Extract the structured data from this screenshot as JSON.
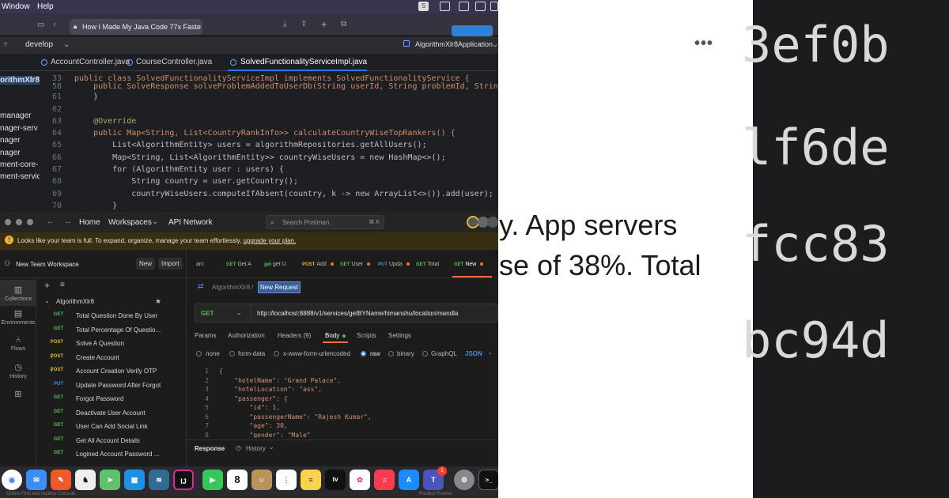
{
  "menubar": {
    "items": [
      "Window",
      "Help"
    ],
    "icons": [
      "s-icon",
      "sidebar-icon",
      "screen-icon",
      "cast-icon",
      "notch-icon"
    ]
  },
  "safari": {
    "url": "How I Made My Java Code 77x Faste"
  },
  "ide": {
    "branch": "develop",
    "run_config": "AlgorithmXlr8Application",
    "tabs": [
      "AccountController.java",
      "CourseController.java",
      "SolvedFunctionalityServiceImpl.java"
    ],
    "project_items": [
      "orithmXlr8",
      "manager",
      "nager-serv",
      "nager",
      "nager",
      "ment-core-",
      "ment-servic"
    ],
    "code": [
      {
        "n": "33",
        "t": "public class SolvedFunctionalityServiceImpl implements SolvedFunctionalityService {"
      },
      {
        "n": "58",
        "t": "    public SolveResponse solveProblemAddedToUserDb(String userId, String problemId, String problem"
      },
      {
        "n": "61",
        "t": "    }"
      },
      {
        "n": "62",
        "t": ""
      },
      {
        "n": "63",
        "t": "    @Override"
      },
      {
        "n": "64",
        "t": "    public Map<String, List<CountryRankInfo>> calculateCountryWiseTopRankers() {"
      },
      {
        "n": "65",
        "t": "        List<AlgorithmEntity> users = algorithmRepositories.getAllUsers();"
      },
      {
        "n": "66",
        "t": "        Map<String, List<AlgorithmEntity>> countryWiseUsers = new HashMap<>();"
      },
      {
        "n": "67",
        "t": "        for (AlgorithmEntity user : users) {"
      },
      {
        "n": "68",
        "t": "            String country = user.getCountry();"
      },
      {
        "n": "69",
        "t": "            countryWiseUsers.computeIfAbsent(country, k -> new ArrayList<>()).add(user);"
      },
      {
        "n": "70",
        "t": "        }"
      }
    ]
  },
  "postman": {
    "nav": {
      "home": "Home",
      "workspaces": "Workspaces",
      "api_network": "API Network",
      "search_placeholder": "Search Postman",
      "shortcut": "⌘ K"
    },
    "banner": {
      "text": "Looks like your team is full. To expand, organize, manage your team effortlessly,",
      "link": "upgrade your plan."
    },
    "workspace": {
      "name": "New Team Workspace",
      "new_label": "New",
      "import_label": "Import"
    },
    "rail": [
      "Collections",
      "Environments",
      "Flows",
      "History"
    ],
    "collection": {
      "name": "AlgorithmXlr8",
      "items": [
        {
          "method": "GET",
          "name": "Total Question Done By User"
        },
        {
          "method": "GET",
          "name": "Total Percentage Of Questio..."
        },
        {
          "method": "POST",
          "name": "Solve A Question"
        },
        {
          "method": "POST",
          "name": "Create Account",
          "folder": true
        },
        {
          "method": "POST",
          "name": "Account Creation Verify OTP",
          "folder": true
        },
        {
          "method": "PUT",
          "name": "Update Password After Forgot"
        },
        {
          "method": "GET",
          "name": "Forgot Password"
        },
        {
          "method": "GET",
          "name": "Deactivate User Account"
        },
        {
          "method": "GET",
          "name": "User Can Add Social Link"
        },
        {
          "method": "GET",
          "name": "Get All Account Details"
        },
        {
          "method": "GET",
          "name": "Logined Account Password ..."
        }
      ]
    },
    "request_tabs": [
      {
        "method": "",
        "name": "arc"
      },
      {
        "method": "GET",
        "name": "Get A"
      },
      {
        "method": "get",
        "name": "get U"
      },
      {
        "method": "POST",
        "name": "Add"
      },
      {
        "method": "GET",
        "name": "User"
      },
      {
        "method": "PUT",
        "name": "Upda"
      },
      {
        "method": "GET",
        "name": "Total"
      },
      {
        "method": "GET",
        "name": "New"
      }
    ],
    "breadcrumb": {
      "parent": "AlgorithmXlr8",
      "current": "New Request"
    },
    "request": {
      "method": "GET",
      "url": "http://localhost:8888/v1/services/getBYName/himanshu/location/mandla"
    },
    "subtabs": [
      "Params",
      "Authorization",
      "Headers (9)",
      "Body",
      "Scripts",
      "Settings"
    ],
    "body_types": [
      "none",
      "form-data",
      "x-www-form-urlencoded",
      "raw",
      "binary",
      "GraphQL"
    ],
    "body_format": "JSON",
    "body_lines": [
      {
        "n": "1",
        "t": "{"
      },
      {
        "n": "2",
        "t": "    \"hotelName\": \"Grand Palace\","
      },
      {
        "n": "3",
        "t": "    \"hotelLocation\": \"ass\","
      },
      {
        "n": "4",
        "t": "    \"passenger\": {"
      },
      {
        "n": "5",
        "t": "        \"id\": 1,"
      },
      {
        "n": "6",
        "t": "        \"passengerName\": \"Rajesh Kumar\","
      },
      {
        "n": "7",
        "t": "        \"age\": 30,"
      },
      {
        "n": "8",
        "t": "        \"gender\": \"Male\""
      }
    ],
    "response": {
      "label": "Response",
      "history": "History"
    }
  },
  "dock": {
    "calendar_day": "8",
    "badge": "1",
    "apps": [
      "chrome",
      "mail",
      "pen",
      "kit",
      "maps",
      "docker",
      "mysql",
      "intellij",
      "facetime",
      "calendar",
      "contacts",
      "reminders",
      "notes",
      "appletv",
      "photos",
      "music",
      "appstore",
      "teams",
      "settings",
      "terminal"
    ],
    "atv": "tv",
    "status_left": "Online   Find and replace   Console",
    "status_right": "Postbot   Runner"
  },
  "article": {
    "line1": "y. App servers",
    "line2": "se of 38%. Total"
  },
  "terminal": {
    "lines": [
      "3ef0b",
      "lf6de",
      "fcc83",
      "bc94d"
    ]
  }
}
